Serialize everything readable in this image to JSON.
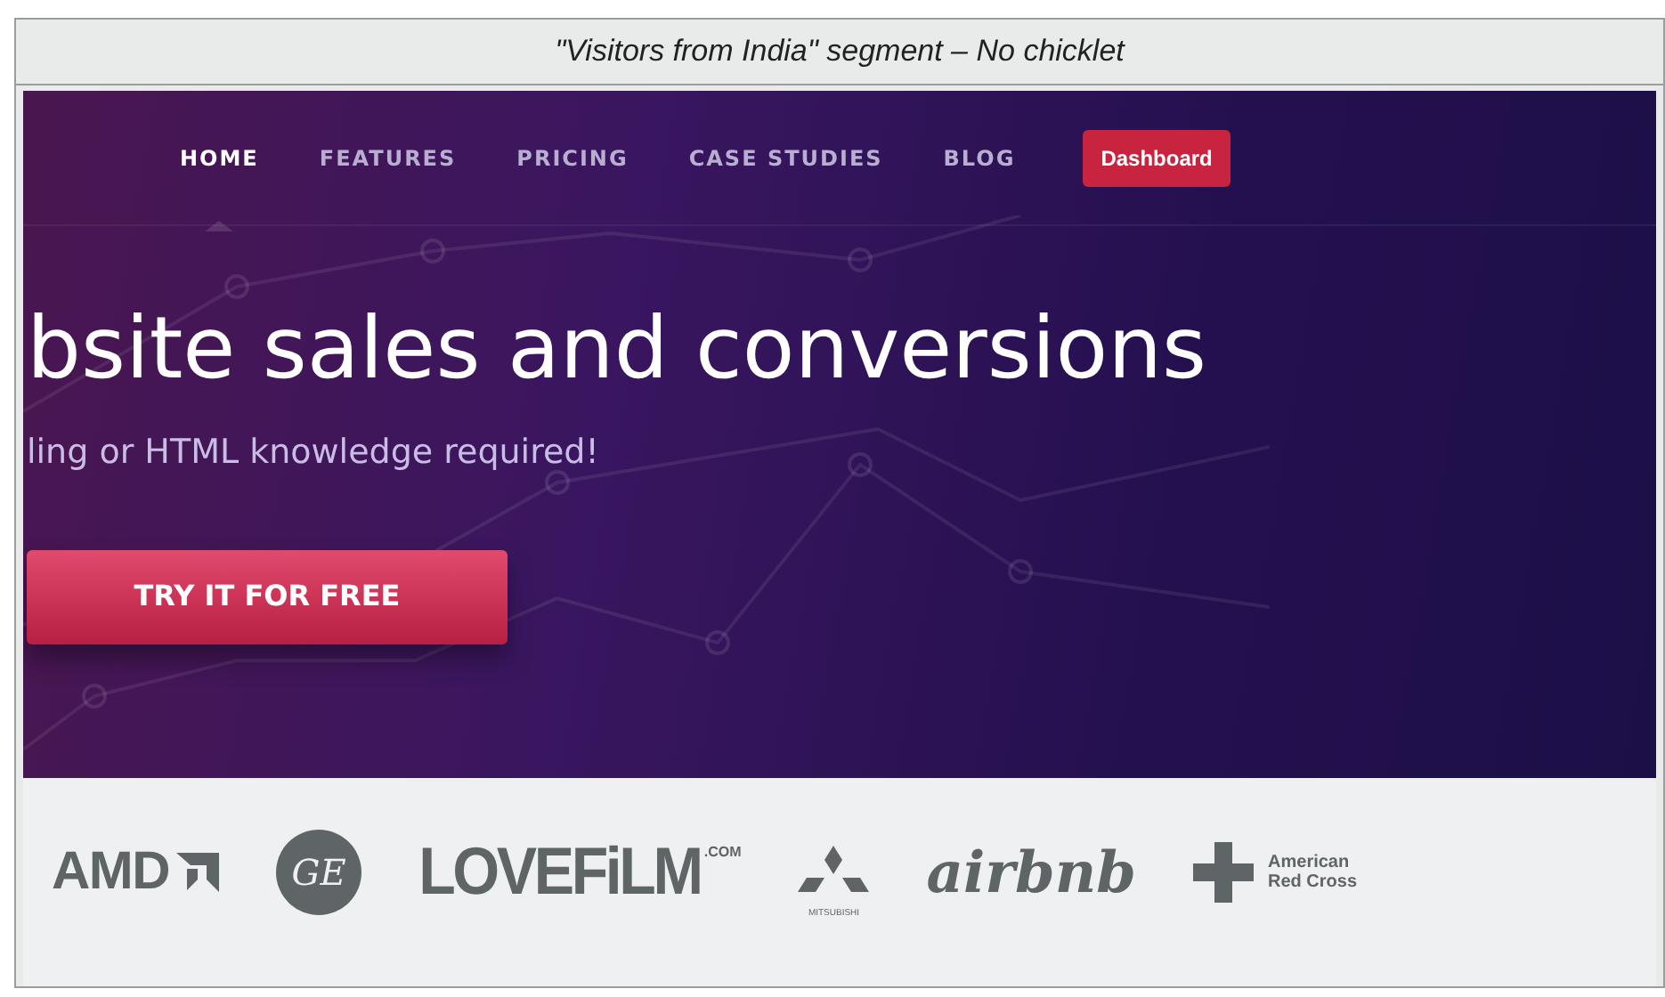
{
  "caption": "\"Visitors from India\" segment – No chicklet",
  "nav": {
    "items": [
      {
        "label": "HOME",
        "selected": true
      },
      {
        "label": "FEATURES",
        "selected": false
      },
      {
        "label": "PRICING",
        "selected": false
      },
      {
        "label": "CASE STUDIES",
        "selected": false
      },
      {
        "label": "BLOG",
        "selected": false
      }
    ],
    "dashboard_button": "Dashboard"
  },
  "hero": {
    "headline": "bsite sales and conversions",
    "subtitle": "ling or HTML knowledge required!",
    "cta": "TRY IT FOR FREE"
  },
  "logos": [
    {
      "kind": "amd",
      "text": "AMD"
    },
    {
      "kind": "ge",
      "text": "GE"
    },
    {
      "kind": "lovefilm",
      "text": "LOVEFiLM",
      "suffix": ".COM"
    },
    {
      "kind": "mitsubishi",
      "text": "MITSUBISHI"
    },
    {
      "kind": "airbnb",
      "text": "airbnb"
    },
    {
      "kind": "redcross",
      "lines": [
        "American",
        "Red Cross"
      ]
    }
  ]
}
